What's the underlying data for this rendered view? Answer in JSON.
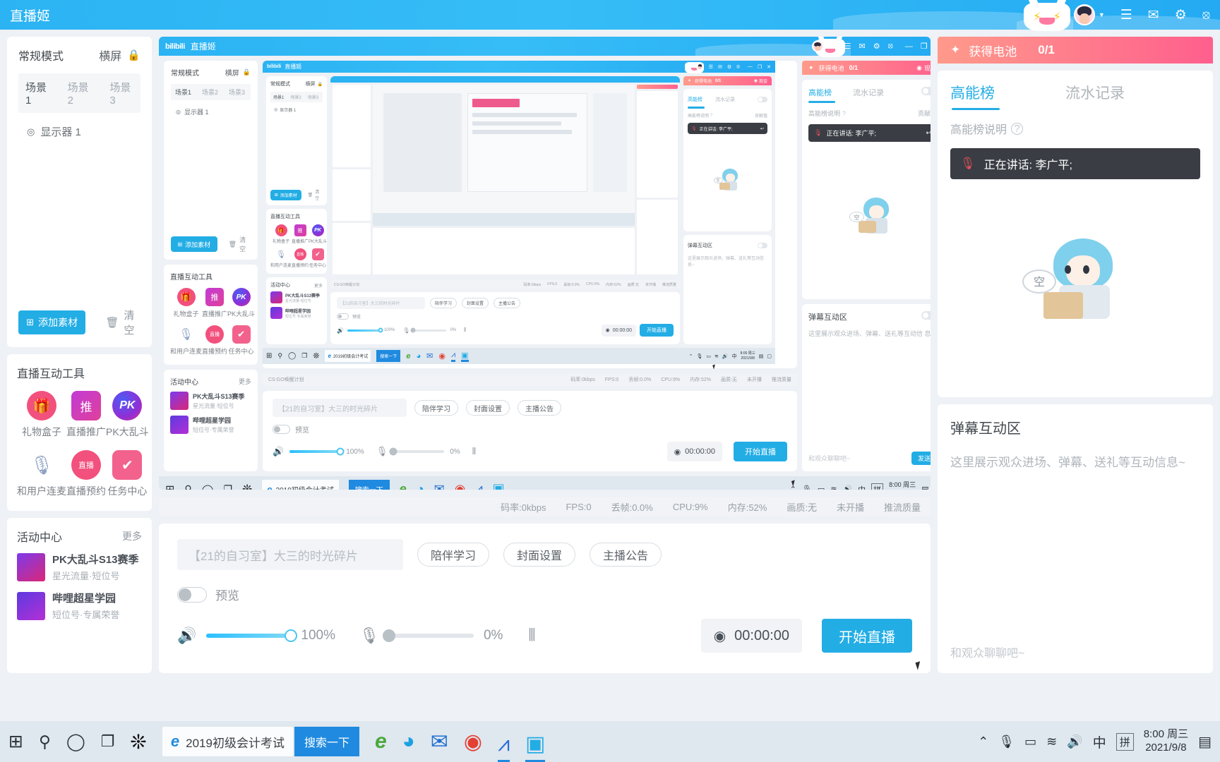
{
  "app": {
    "brand_logo": "bilibili",
    "title": "直播姬",
    "titlebar_icons": [
      "menu-icon",
      "mail-icon",
      "gear-icon",
      "share-icon"
    ],
    "window_controls": [
      "minimize",
      "maximize",
      "close"
    ]
  },
  "scene_panel": {
    "mode_label": "常规模式",
    "orientation_label": "横屏",
    "lock_icon": "lock-icon",
    "tabs": [
      "场景1",
      "场景2",
      "场景3"
    ],
    "active_tab": "场景1",
    "sources": [
      {
        "eye_icon": "eye-icon",
        "name": "显示器 1"
      }
    ],
    "add_button": "添加素材",
    "clear_button": "清空",
    "trash_icon": "trash-icon",
    "plus_icon": "plus-square-icon"
  },
  "tools_panel": {
    "title": "直播互动工具",
    "items": [
      {
        "label": "礼物盒子",
        "icon": "gift-box-icon",
        "color": "#f2507d"
      },
      {
        "label": "直播推广",
        "icon": "promote-icon",
        "color": "#c13bd6"
      },
      {
        "label": "PK大乱斗",
        "icon": "pk-icon",
        "color": "#7c2fd4"
      },
      {
        "label": "和用户连麦",
        "icon": "microphone-link-icon",
        "color": "#8fa3c4"
      },
      {
        "label": "直播预约",
        "icon": "calendar-live-icon",
        "color": "#f2507d"
      },
      {
        "label": "任务中心",
        "icon": "task-check-icon",
        "color": "#f2628c"
      }
    ]
  },
  "activity_panel": {
    "title": "活动中心",
    "more_label": "更多",
    "items": [
      {
        "title": "PK大乱斗S13赛季",
        "subtitle": "星光流量·短位号"
      },
      {
        "title": "哔哩超星学园",
        "subtitle": "短位号·专属荣誉"
      }
    ]
  },
  "stream_controls": {
    "room_title": "【21的自习室】大三的时光碎片",
    "pills": [
      "陪伴学习",
      "封面设置",
      "主播公告"
    ],
    "preview_label": "预览",
    "preview_on": false,
    "speaker_icon": "speaker-icon",
    "speaker_value": "100%",
    "speaker_percent": 100,
    "mic_icon": "mic-muted-icon",
    "mic_value": "0%",
    "mic_percent": 0,
    "mixer_icon": "equalizer-icon",
    "timer": "00:00:00",
    "record_icon": "record-dot-icon",
    "go_live_label": "开始直播"
  },
  "right_panel": {
    "battery_label": "获得电池",
    "battery_value": "0/1",
    "battery_star_icon": "star-icon",
    "gold_label": "现金",
    "gold_icon": "coin-icon",
    "tabs": [
      "高能榜",
      "流水记录"
    ],
    "active_tab": "高能榜",
    "rank_help_label": "高能榜说明",
    "help_icon": "question-circle-icon",
    "contribution_label": "贡献值",
    "toggle_icon": "toggle-switch-icon",
    "speaking_toast": "正在讲话: 李广平;",
    "speaking_mic_icon": "mic-muted-red-icon",
    "reply_icon": "reply-arrow-icon",
    "empty_bubble": "空",
    "danmaku_title": "弹幕互动区",
    "danmaku_placeholder_line1": "这里展示观众进场、弹幕、送礼等互动信",
    "danmaku_placeholder_line2": "息~",
    "chat_placeholder": "和观众聊聊吧~",
    "send_label": "发送"
  },
  "statusbar": {
    "record_plan": "CS:GO唤醒计划",
    "items": [
      "码率:0kbps",
      "FPS:0",
      "丢帧:0.0%",
      "CPU:9%",
      "内存:52%",
      "画质:无",
      "未开播",
      "推流质量"
    ]
  },
  "taskbar": {
    "start_icon": "windows-start-icon",
    "search_icon": "search-icon",
    "cortana_icon": "cortana-circle-icon",
    "taskview_icon": "task-view-icon",
    "apps": [
      {
        "name": "obs-icon"
      },
      {
        "name": "ie-search-box"
      },
      {
        "name": "ie-classic-icon"
      },
      {
        "name": "edge-icon"
      },
      {
        "name": "mail-icon"
      },
      {
        "name": "chrome-colorful-icon"
      },
      {
        "name": "migu-icon"
      },
      {
        "name": "bililive-icon"
      }
    ],
    "search_text": "2019初级会计考试",
    "search_button": "搜索一下",
    "tray_icons": [
      "chevron-up-icon",
      "microphone-icon",
      "battery-icon",
      "wifi-icon",
      "volume-icon"
    ],
    "ime_cn": "中",
    "ime_pin": "拼",
    "clock_time": "8:00 周三",
    "clock_date": "2021/9/8",
    "notify_icon": "notification-icon",
    "note_icon": "sticky-note-icon"
  },
  "colors": {
    "brand_blue": "#23ade5",
    "pink": "#f2507d",
    "taskbar": "#dfe7ef"
  }
}
